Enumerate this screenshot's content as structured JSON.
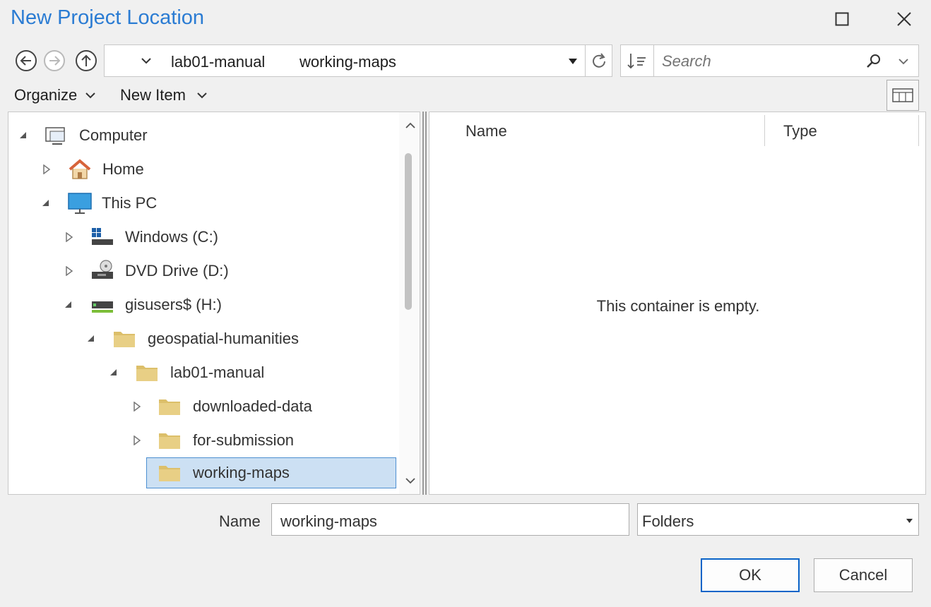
{
  "dialog": {
    "title": "New Project Location"
  },
  "toolbar": {
    "breadcrumb": [
      "lab01-manual",
      "working-maps"
    ],
    "search_placeholder": "Search"
  },
  "menu": {
    "organize": "Organize",
    "new_item": "New Item"
  },
  "tree": {
    "computer": "Computer",
    "home": "Home",
    "this_pc": "This PC",
    "windows": "Windows (C:)",
    "dvd": "DVD Drive (D:)",
    "gisusers": "gisusers$ (H:)",
    "geospatial": "geospatial-humanities",
    "lab01": "lab01-manual",
    "downloaded": "downloaded-data",
    "submission": "for-submission",
    "working": "working-maps"
  },
  "content": {
    "columns": [
      "Name",
      "Type"
    ],
    "empty_message": "This container is empty."
  },
  "footer": {
    "name_label": "Name",
    "name_value": "working-maps",
    "filter_value": "Folders",
    "ok": "OK",
    "cancel": "Cancel"
  },
  "colors": {
    "accent": "#2b7cd3",
    "selection": "#cce0f3",
    "folder": "#dcbf6a"
  }
}
